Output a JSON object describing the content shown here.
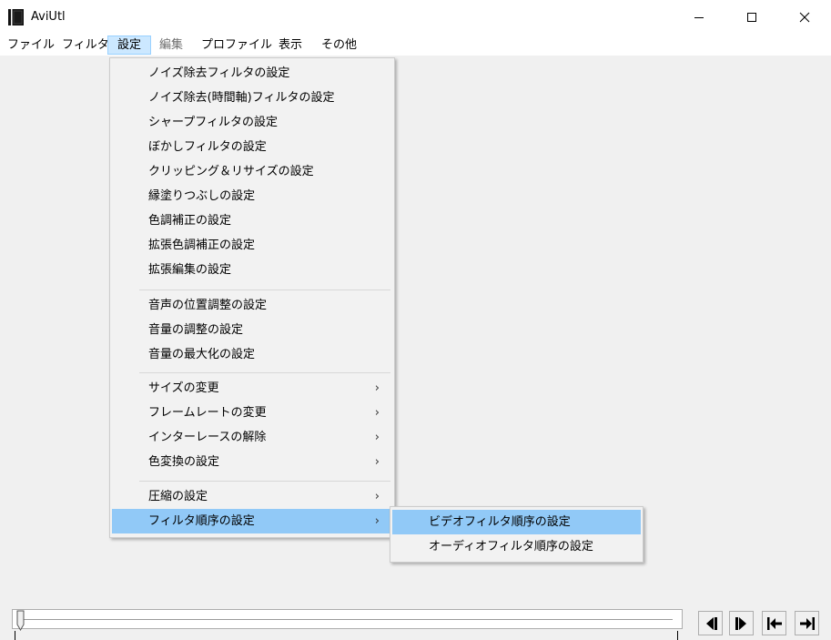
{
  "window": {
    "title": "AviUtl",
    "minimize_icon": "minimize-icon",
    "maximize_icon": "maximize-icon",
    "close_icon": "close-icon"
  },
  "menubar": {
    "items": [
      {
        "label": "ファイル",
        "state": "normal"
      },
      {
        "label": "フィルタ",
        "state": "normal"
      },
      {
        "label": "設定",
        "state": "active"
      },
      {
        "label": "編集",
        "state": "disabled"
      },
      {
        "label": "プロファイル",
        "state": "normal"
      },
      {
        "label": "表示",
        "state": "normal"
      },
      {
        "label": "その他",
        "state": "normal"
      }
    ]
  },
  "settings_menu": {
    "items": [
      {
        "label": "ノイズ除去フィルタの設定"
      },
      {
        "label": "ノイズ除去(時間軸)フィルタの設定"
      },
      {
        "label": "シャープフィルタの設定"
      },
      {
        "label": "ぼかしフィルタの設定"
      },
      {
        "label": "クリッピング＆リサイズの設定"
      },
      {
        "label": "縁塗りつぶしの設定"
      },
      {
        "label": "色調補正の設定"
      },
      {
        "label": "拡張色調補正の設定"
      },
      {
        "label": "拡張編集の設定"
      },
      {
        "label": "音声の位置調整の設定"
      },
      {
        "label": "音量の調整の設定"
      },
      {
        "label": "音量の最大化の設定"
      },
      {
        "label": "サイズの変更",
        "submenu": true
      },
      {
        "label": "フレームレートの変更",
        "submenu": true
      },
      {
        "label": "インターレースの解除",
        "submenu": true
      },
      {
        "label": "色変換の設定",
        "submenu": true
      },
      {
        "label": "圧縮の設定",
        "submenu": true
      },
      {
        "label": "フィルタ順序の設定",
        "submenu": true,
        "highlighted": true
      }
    ],
    "arrow_glyph": "›"
  },
  "filter_order_submenu": {
    "items": [
      {
        "label": "ビデオフィルタ順序の設定",
        "highlighted": true
      },
      {
        "label": "オーディオフィルタ順序の設定"
      }
    ]
  },
  "playback_controls": {
    "buttons": [
      {
        "name": "step-back-button",
        "icon": "step-back-icon"
      },
      {
        "name": "step-forward-button",
        "icon": "step-forward-icon"
      },
      {
        "name": "go-to-start-button",
        "icon": "go-to-start-icon"
      },
      {
        "name": "go-to-end-button",
        "icon": "go-to-end-icon"
      }
    ]
  },
  "colors": {
    "menu_highlight": "#91c9f7",
    "menubar_active": "#cce8ff",
    "background": "#f0f0f0"
  }
}
